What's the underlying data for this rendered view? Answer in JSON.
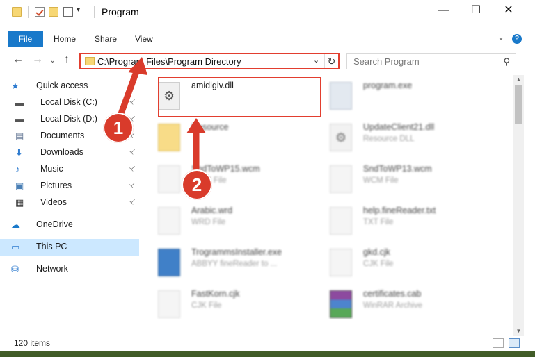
{
  "window": {
    "title": "Program",
    "controls": {
      "minimize": "—",
      "maximize": "☐",
      "close": "✕"
    },
    "qat_arrow": "▾"
  },
  "ribbon": {
    "file": "File",
    "tabs": [
      "Home",
      "Share",
      "View"
    ],
    "help": "?",
    "collapse": "⌄"
  },
  "nav": {
    "back": "←",
    "forward": "→",
    "recent": "⌄",
    "up": "↑",
    "address": "C:\\Program Files\\Program Directory",
    "address_dropdown": "⌄",
    "refresh": "↻",
    "search_placeholder": "Search Program",
    "search_icon": "⚲"
  },
  "sidebar": {
    "items": [
      {
        "label": "Quick access",
        "icon": "star-icon",
        "glyph": "★",
        "color": "#2e7bcf"
      },
      {
        "label": "Local Disk (C:)",
        "icon": "drive-icon",
        "glyph": "▬",
        "color": "#555555",
        "pinned": true
      },
      {
        "label": "Local Disk (D:)",
        "icon": "drive-icon",
        "glyph": "▬",
        "color": "#555555",
        "pinned": true
      },
      {
        "label": "Documents",
        "icon": "documents-icon",
        "glyph": "▤",
        "color": "#6b7d99",
        "pinned": true
      },
      {
        "label": "Downloads",
        "icon": "download-icon",
        "glyph": "⬇",
        "color": "#2e7bcf",
        "pinned": true
      },
      {
        "label": "Music",
        "icon": "music-icon",
        "glyph": "♪",
        "color": "#2e7bcf",
        "pinned": true
      },
      {
        "label": "Pictures",
        "icon": "pictures-icon",
        "glyph": "▣",
        "color": "#4a7fb5",
        "pinned": true
      },
      {
        "label": "Videos",
        "icon": "videos-icon",
        "glyph": "▦",
        "color": "#333333",
        "pinned": true
      },
      {
        "label": "OneDrive",
        "icon": "cloud-icon",
        "glyph": "☁",
        "color": "#1979ca"
      },
      {
        "label": "This PC",
        "icon": "computer-icon",
        "glyph": "▭",
        "color": "#2e7bcf",
        "selected": true
      },
      {
        "label": "Network",
        "icon": "network-icon",
        "glyph": "⛁",
        "color": "#2e7bcf"
      }
    ],
    "pin_glyph": "📌"
  },
  "files": [
    {
      "name": "amidlgiv.dll",
      "type": "",
      "icon": "gear",
      "highlighted": true
    },
    {
      "name": "program.exe",
      "type": "",
      "icon": "program"
    },
    {
      "name": "Resource",
      "type": "",
      "icon": "folder"
    },
    {
      "name": "UpdateClient21.dll",
      "type": "Resource DLL",
      "icon": "gear"
    },
    {
      "name": "SndToWP15.wcm",
      "type": "WCM File",
      "icon": "doc"
    },
    {
      "name": "SndToWP13.wcm",
      "type": "WCM File",
      "icon": "doc"
    },
    {
      "name": "Arabic.wrd",
      "type": "WRD File",
      "icon": "doc"
    },
    {
      "name": "help.fineReader.txt",
      "type": "TXT File",
      "icon": "doc"
    },
    {
      "name": "TrogrammsInstaller.exe",
      "type": "ABBYY fineReader to ...",
      "icon": "installer"
    },
    {
      "name": "gkd.cjk",
      "type": "CJK File",
      "icon": "doc"
    },
    {
      "name": "FastKorn.cjk",
      "type": "CJK File",
      "icon": "doc"
    },
    {
      "name": "certificates.cab",
      "type": "WinRAR Archive",
      "icon": "winrar"
    }
  ],
  "status": {
    "items": "120 items"
  },
  "callouts": [
    "1",
    "2"
  ],
  "colors": {
    "accent": "#1979ca",
    "highlight": "#e23e2f",
    "callout": "#d93b2b",
    "selection": "#cce8ff"
  }
}
